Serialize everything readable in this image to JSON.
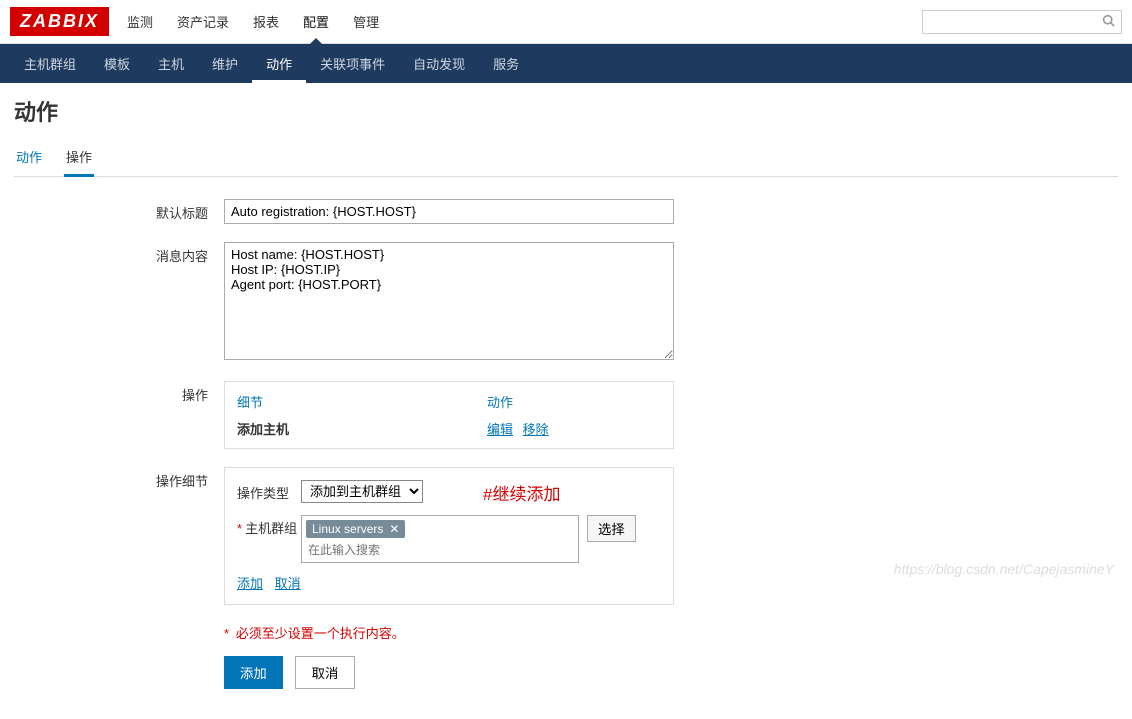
{
  "logo": "ZABBIX",
  "topnav": [
    "监测",
    "资产记录",
    "报表",
    "配置",
    "管理"
  ],
  "topnav_active": 3,
  "search": {
    "placeholder": ""
  },
  "subnav": [
    "主机群组",
    "模板",
    "主机",
    "维护",
    "动作",
    "关联项事件",
    "自动发现",
    "服务"
  ],
  "subnav_active": 4,
  "page_title": "动作",
  "tabs": [
    "动作",
    "操作"
  ],
  "tab_active": 1,
  "form": {
    "default_title_label": "默认标题",
    "default_title_value": "Auto registration: {HOST.HOST}",
    "message_label": "消息内容",
    "message_value": "Host name: {HOST.HOST}\nHost IP: {HOST.IP}\nAgent port: {HOST.PORT}",
    "operations_label": "操作",
    "op_head_detail": "细节",
    "op_head_action": "动作",
    "op_row_detail": "添加主机",
    "op_edit": "编辑",
    "op_remove": "移除",
    "detail_label": "操作细节",
    "op_type_label": "操作类型",
    "op_type_value": "添加到主机群组",
    "annotation": "#继续添加",
    "hostgroup_label": "主机群组",
    "hostgroup_tag": "Linux servers",
    "hostgroup_placeholder": "在此输入搜索",
    "select_btn": "选择",
    "add_link": "添加",
    "cancel_link": "取消",
    "warn_text": "必须至少设置一个执行内容。",
    "btn_add": "添加",
    "btn_cancel": "取消"
  },
  "watermark": "https://blog.csdn.net/CapejasmineY"
}
